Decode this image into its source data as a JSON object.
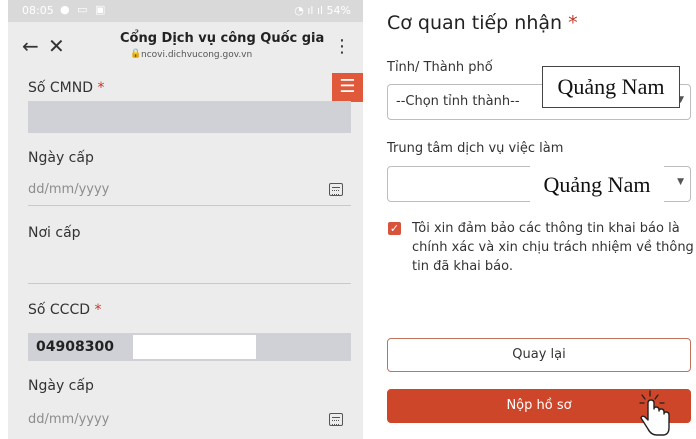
{
  "phone": {
    "status": {
      "time": "08:05",
      "battery": "54%"
    },
    "browser": {
      "title": "Cổng Dịch vụ công Quốc gia",
      "url": "ncovi.dichvucong.gov.vn"
    },
    "fields": {
      "cmnd_label": "Số CMND",
      "required_mark": "*",
      "issue_date_label_1": "Ngày cấp",
      "date_placeholder": "dd/mm/yyyy",
      "issue_place_label": "Nơi cấp",
      "cccd_label": "Số CCCD",
      "cccd_value": "04908300",
      "issue_date_label_2": "Ngày cấp"
    },
    "accent": "#e0593a"
  },
  "form": {
    "title": "Cơ quan tiếp nhận",
    "required_mark": "*",
    "province_label": "Tỉnh/ Thành phố",
    "province_placeholder": "--Chọn tỉnh thành--",
    "province_overlay": "Quảng Nam",
    "center_label": "Trung tâm dịch vụ việc làm",
    "center_overlay": "Quảng Nam",
    "consent_text": "Tôi xin đảm bảo các thông tin khai báo là chính xác và xin chịu trách nhiệm về thông tin đã khai báo.",
    "consent_checked": true,
    "back_button": "Quay lại",
    "submit_button": "Nộp hồ sơ",
    "primary_color": "#cd4629"
  }
}
